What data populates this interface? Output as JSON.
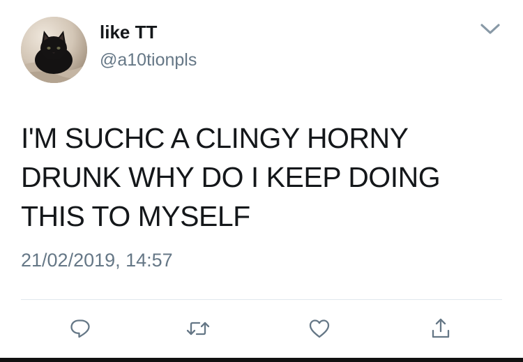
{
  "tweet": {
    "display_name": "like TT",
    "handle": "@a10tionpls",
    "text": "I'M SUCHC A CLINGY HORNY DRUNK WHY DO I KEEP DOING THIS TO MYSELF",
    "timestamp": "21/02/2019, 14:57"
  },
  "icons": {
    "caret": "chevron-down-icon",
    "reply": "reply-icon",
    "retweet": "retweet-icon",
    "like": "heart-icon",
    "share": "share-icon"
  },
  "colors": {
    "text": "#14171a",
    "secondary": "#657786",
    "icon": "#657786",
    "divider": "#e1e8ed"
  }
}
